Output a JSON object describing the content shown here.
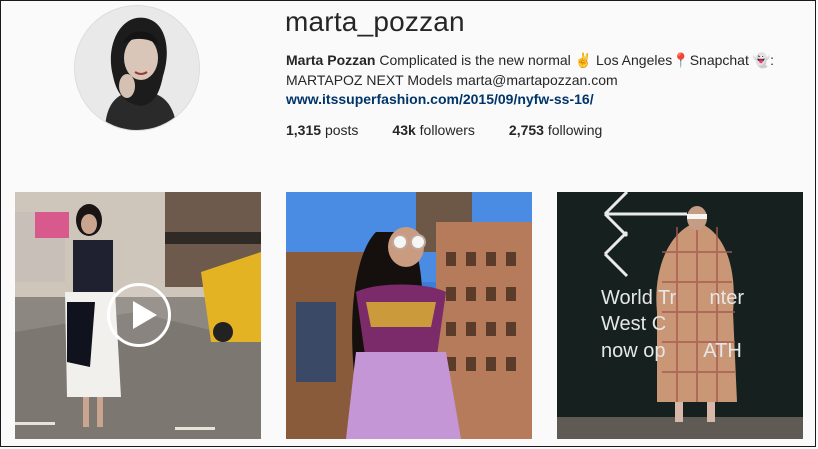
{
  "profile": {
    "username": "marta_pozzan",
    "full_name": "Marta Pozzan",
    "bio_line1": "Complicated is the new normal ✌ Los Angeles📍Snapchat 👻:",
    "bio_line2": "MARTAPOZ NEXT Models marta@martapozzan.com",
    "website": "www.itssuperfashion.com/2015/09/nyfw-ss-16/",
    "stats": {
      "posts_count": "1,315",
      "posts_label": "posts",
      "followers_count": "43k",
      "followers_label": "followers",
      "following_count": "2,753",
      "following_label": "following"
    }
  },
  "posts": [
    {
      "type": "video",
      "icon": "play-icon"
    },
    {
      "type": "photo"
    },
    {
      "type": "photo",
      "sign_line1": "World Tr      nter",
      "sign_line2": "West C",
      "sign_line3": "now op       ATH"
    }
  ],
  "colors": {
    "background": "#fafafa",
    "link": "#003569",
    "text": "#262626"
  }
}
